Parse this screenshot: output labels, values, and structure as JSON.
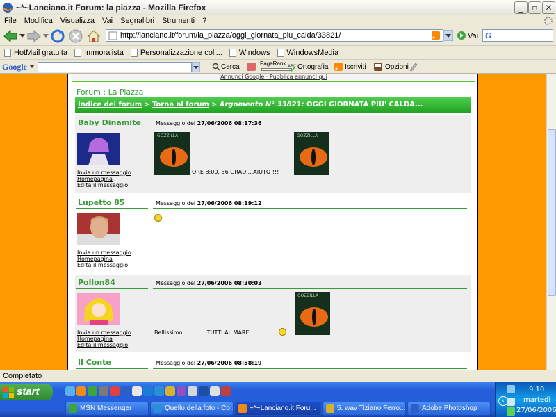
{
  "window": {
    "title": "~*~Lanciano.it Forum: la piazza - Mozilla Firefox"
  },
  "menu": [
    "File",
    "Modifica",
    "Visualizza",
    "Vai",
    "Segnalibri",
    "Strumenti",
    "?"
  ],
  "nav": {
    "url": "http://lanciano.it/forum/la_piazza/oggi_giornata_piu_calda/33821/",
    "go": "Vai",
    "search_logo": "G"
  },
  "bookmarks": [
    "HotMail gratuita",
    "Immoralista",
    "Personalizzazione coll...",
    "Windows",
    "WindowsMedia"
  ],
  "googlebar": {
    "logo": "Google",
    "items": [
      "Cerca",
      "PageRank",
      "Ortografia",
      "Iscriviti",
      "Opzioni"
    ]
  },
  "page": {
    "ads": "Annunci Google · Pubblica annunci qui",
    "forum_title": "Forum : La Piazza",
    "breadcrumb": {
      "index": "Indice dei forum",
      "sep1": " > ",
      "back": "Torna al forum",
      "sep2": " > ",
      "topic_label": "Argomento N° 33821:",
      "topic": " OGGI GIORNATA PIU' CALDA..."
    },
    "posts": [
      {
        "author": "Baby Dinamite",
        "date_prefix": "Messaggio del ",
        "date": "27/06/2006 08:17:36",
        "text": "ORE 8:00, 36 GRADI...AIUTO !!!",
        "links": [
          "Invia un messaggio",
          "Homepagina",
          "Edita il messaggio"
        ]
      },
      {
        "author": "Lupetto 85",
        "date_prefix": "Messaggio del ",
        "date": "27/06/2006 08:19:12",
        "text": "",
        "links": [
          "Invia un messaggio",
          "Homepagina",
          "Edita il messaggio"
        ]
      },
      {
        "author": "Pollon84",
        "date_prefix": "Messaggio del ",
        "date": "27/06/2006 08:30:03",
        "text": "Bellissimo............. TUTTI AL MARE....",
        "links": [
          "Invia un messaggio",
          "Homepagina",
          "Edita il messaggio"
        ]
      },
      {
        "author": "Il Conte",
        "date_prefix": "Messaggio del ",
        "date": "27/06/2006 08:58:19",
        "text": "",
        "links": []
      }
    ],
    "gz_text": "GOZZILLA"
  },
  "status": {
    "text": "Completato"
  },
  "taskbar": {
    "start": "start",
    "tasks": [
      "MSN Messenger",
      "Quello della foto - Co...",
      "~*~Lanciano.it Foru...",
      "5.  wav Tiziano Ferro...",
      "Adobe Photoshop"
    ],
    "clock": {
      "time": "9.10",
      "day": "martedì",
      "date": "27/06/2006"
    }
  },
  "colors": {
    "accent_green": "#3a9a3a",
    "orange_bg": "#ff9900",
    "nav_green": "#20a020"
  }
}
